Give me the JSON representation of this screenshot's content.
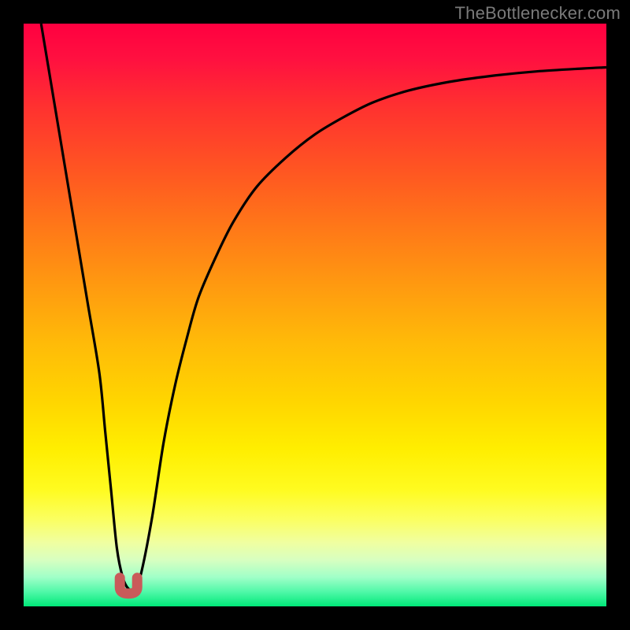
{
  "watermark": {
    "text": "TheBottlenecker.com"
  },
  "colors": {
    "curve_stroke": "#000000",
    "marker_fill": "#c95a5a",
    "marker_stroke": "#b44848",
    "frame": "#000000"
  },
  "chart_data": {
    "type": "line",
    "title": "",
    "xlabel": "",
    "ylabel": "",
    "xlim": [
      0,
      100
    ],
    "ylim": [
      0,
      100
    ],
    "x": [
      3,
      5,
      7,
      9,
      11,
      13,
      14,
      15,
      16,
      17,
      18,
      19,
      20,
      22,
      24,
      26,
      28,
      30,
      33,
      36,
      40,
      45,
      50,
      55,
      60,
      66,
      73,
      80,
      88,
      96,
      100
    ],
    "y": [
      100,
      88,
      76,
      64,
      52,
      40,
      30,
      20,
      10,
      5,
      3,
      3,
      5,
      15,
      28,
      38,
      46,
      53,
      60,
      66,
      72,
      77,
      81,
      84,
      86.5,
      88.5,
      90,
      91,
      91.8,
      92.3,
      92.5
    ],
    "minimum_marker": {
      "x": 18,
      "y": 3,
      "shape": "U"
    },
    "grid": false,
    "legend": false
  }
}
